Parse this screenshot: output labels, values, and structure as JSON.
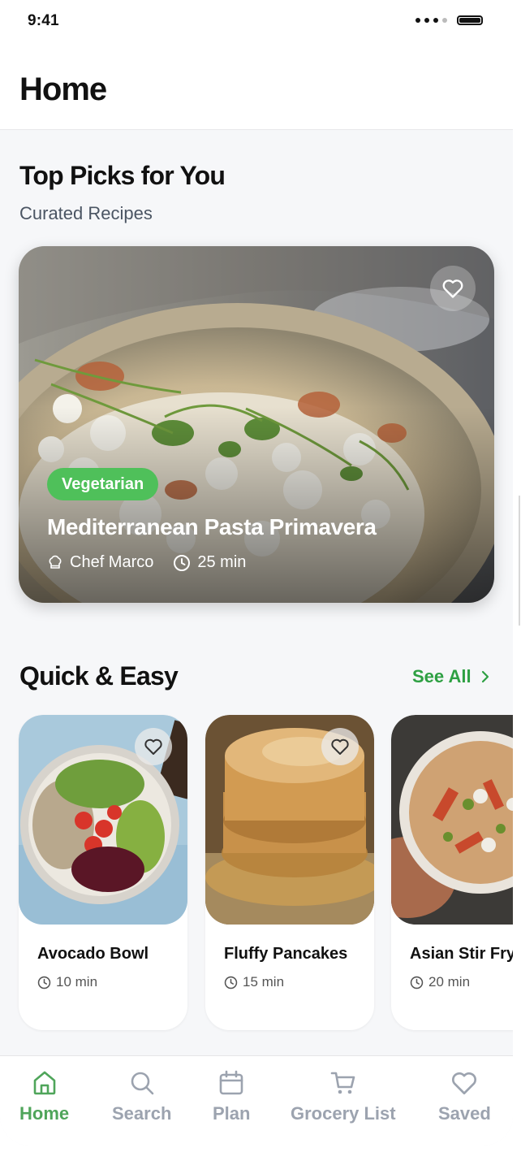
{
  "status_bar": {
    "time": "9:41"
  },
  "header": {
    "title": "Home"
  },
  "top_picks": {
    "title": "Top Picks for You",
    "subtitle": "Curated Recipes",
    "featured": {
      "tag": "Vegetarian",
      "title": "Mediterranean Pasta Primavera",
      "chef": "Chef Marco",
      "time": "25 min"
    }
  },
  "quick_easy": {
    "title": "Quick & Easy",
    "see_all": "See All",
    "recipes": [
      {
        "name": "Avocado Bowl",
        "time": "10 min"
      },
      {
        "name": "Fluffy Pancakes",
        "time": "15 min"
      },
      {
        "name": "Asian Stir Fry",
        "time": "20 min"
      }
    ]
  },
  "tabbar": {
    "items": [
      {
        "label": "Home",
        "icon": "home-icon",
        "active": true
      },
      {
        "label": "Search",
        "icon": "search-icon"
      },
      {
        "label": "Plan",
        "icon": "calendar-icon"
      },
      {
        "label": "Grocery List",
        "icon": "cart-icon"
      },
      {
        "label": "Saved",
        "icon": "heart-icon"
      }
    ]
  },
  "colors": {
    "accent": "#4fc05a",
    "link": "#2ea043",
    "active_tab": "#4fa55a",
    "inactive_tab": "#9ca3af"
  }
}
